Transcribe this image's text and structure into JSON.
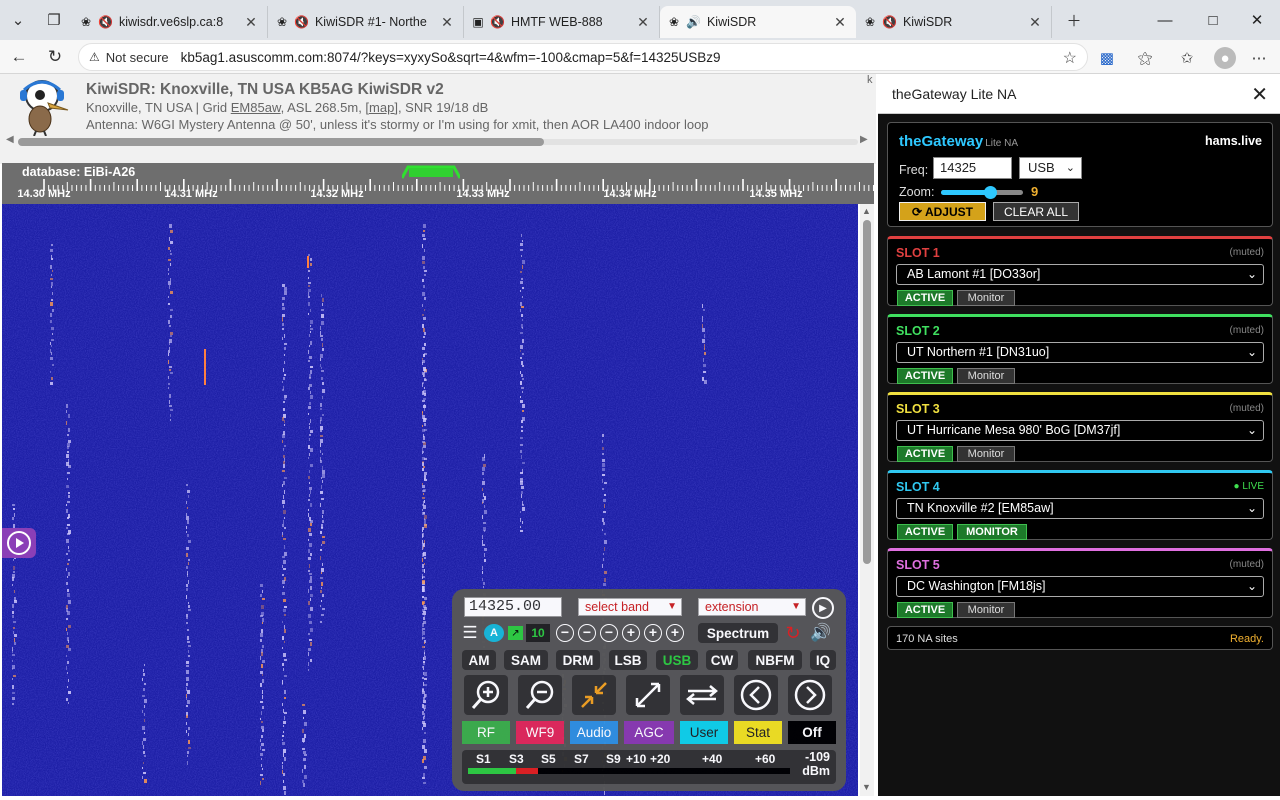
{
  "browser": {
    "tabs": [
      {
        "title": "kiwisdr.ve6slp.ca:8",
        "muted": true
      },
      {
        "title": "KiwiSDR #1- Northe",
        "muted": true
      },
      {
        "title": "HMTF WEB-888",
        "muted": true
      },
      {
        "title": "KiwiSDR",
        "muted": false,
        "active": true
      },
      {
        "title": "KiwiSDR",
        "muted": true
      }
    ],
    "security_label": "Not secure",
    "url": "kb5ag1.asuscomm.com:8074/?keys=xyxySo&sqrt=4&wfm=-100&cmap=5&f=14325USBz9"
  },
  "kiwi": {
    "title": "KiwiSDR: Knoxville, TN USA KB5AG KiwiSDR v2",
    "loc_prefix": "Knoxville, TN USA | Grid ",
    "grid": "EM85aw",
    "asl": ", ASL 268.5m, ",
    "map": "[map]",
    "snr": ", SNR 19/18 dB",
    "antenna": "Antenna: W6GI Mystery Antenna @ 50', unless it's stormy or I'm using for xmit, then AOR LA400 indoor loop",
    "database": "database: EiBi-A26",
    "scale_labels": [
      "14.30 MHz",
      "14.31 MHz",
      "14.32 MHz",
      "14.33 MHz",
      "14.34 MHz",
      "14.35 MHz"
    ],
    "edge_letter": "k"
  },
  "control": {
    "frequency": "14325.00",
    "band_select": "select band",
    "extension_select": "extension",
    "agc_badge": "A",
    "zoom_badge": "10",
    "spectrum_label": "Spectrum",
    "modes": [
      "AM",
      "SAM",
      "DRM",
      "LSB",
      "USB",
      "CW",
      "NBFM",
      "IQ"
    ],
    "active_mode": "USB",
    "panel_tabs": [
      "RF",
      "WF9",
      "Audio",
      "AGC",
      "User",
      "Stat",
      "Off"
    ],
    "smeter_labels": [
      "S1",
      "S3",
      "S5",
      "S7",
      "S9",
      "+10",
      "+20",
      "+40",
      "+60"
    ],
    "smeter_value": "-109",
    "smeter_unit": "dBm",
    "colors": {
      "rf": "#3cae4a",
      "wf": "#e0295a",
      "audio": "#3090e0",
      "agc": "#8a3ab0",
      "user": "#10d0e8",
      "stat": "#f0e020",
      "off": "#000000"
    }
  },
  "panel": {
    "title": "theGateway Lite NA",
    "brand": "theGateway",
    "brand_sub": "Lite NA",
    "hams_live": "hams.live",
    "freq_label": "Freq:",
    "freq_value": "14325",
    "mode_value": "USB",
    "zoom_label": "Zoom:",
    "zoom_value": "9",
    "zoom_level_fraction": 0.6,
    "adjust_label": "⟳ ADJUST",
    "clear_label": "CLEAR ALL",
    "slots": [
      {
        "name": "SLOT 1",
        "status": "(muted)",
        "site": "AB Lamont #1 [DO33or]",
        "active": "ACTIVE",
        "monitor": "Monitor",
        "color": "#e04040"
      },
      {
        "name": "SLOT 2",
        "status": "(muted)",
        "site": "UT Northern #1 [DN31uo]",
        "active": "ACTIVE",
        "monitor": "Monitor",
        "color": "#40e060"
      },
      {
        "name": "SLOT 3",
        "status": "(muted)",
        "site": "UT Hurricane Mesa 980' BoG [DM37jf]",
        "active": "ACTIVE",
        "monitor": "Monitor",
        "color": "#f0e040"
      },
      {
        "name": "SLOT 4",
        "status": "● LIVE",
        "site": "TN Knoxville #2 [EM85aw]",
        "active": "ACTIVE",
        "monitor": "MONITOR",
        "color": "#30c8f0",
        "live": true
      },
      {
        "name": "SLOT 5",
        "status": "(muted)",
        "site": "DC Washington [FM18js]",
        "active": "ACTIVE",
        "monitor": "Monitor",
        "color": "#e070e0"
      }
    ],
    "sites_count": "170 NA sites",
    "status": "Ready."
  }
}
